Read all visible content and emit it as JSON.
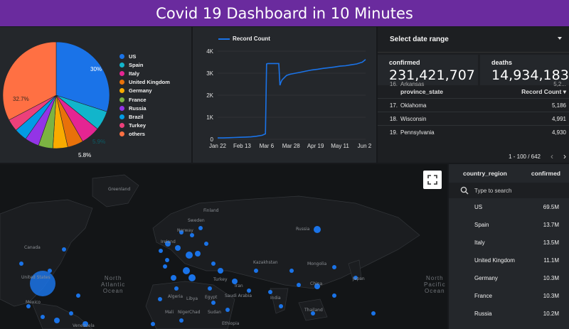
{
  "header": {
    "title": "Covid 19 Dashboard in 10 Minutes"
  },
  "colors": {
    "header_bg": "#6a2b9e",
    "accent_blue": "#1a73e8"
  },
  "pie": {
    "legend": [
      "US",
      "Spain",
      "Italy",
      "United Kingdom",
      "Germany",
      "France",
      "Russia",
      "Brazil",
      "Turkey",
      "others"
    ],
    "labels": {
      "us": "30%",
      "others": "32.7%",
      "spain": "5.9%",
      "turkey": "5.8%"
    }
  },
  "line": {
    "legend": "Record Count"
  },
  "date_range": {
    "label": "Select date range"
  },
  "scorecards": {
    "confirmed": {
      "label": "confirmed",
      "value": "231,421,707"
    },
    "deaths": {
      "label": "deaths",
      "value": "14,934,183"
    }
  },
  "province_table": {
    "headers": {
      "name": "province_state",
      "value": "Record Count"
    },
    "partial_top": {
      "idx": "16.",
      "name": "Arkansas",
      "value": "5,2..."
    },
    "rows": [
      {
        "idx": "17.",
        "name": "Oklahoma",
        "value": "5,186"
      },
      {
        "idx": "18.",
        "name": "Wisconsin",
        "value": "4,991"
      },
      {
        "idx": "19.",
        "name": "Pennsylvania",
        "value": "4,930"
      }
    ],
    "pager": "1 - 100 / 642"
  },
  "map": {
    "labels": {
      "greenland": "Greenland",
      "finland": "Finland",
      "sweden": "Sweden",
      "norway": "Norway",
      "russia": "Russia",
      "canada": "Canada",
      "ireland": "Ireland",
      "kazakhstan": "Kazakhstan",
      "united_states": "United States",
      "mexico": "Mexico",
      "algeria": "Algeria",
      "libya": "Libya",
      "egypt": "Egypt",
      "chad": "Chad",
      "sudan": "Sudan",
      "mali": "Mali",
      "niger": "Niger",
      "saudi": "Saudi Arabia",
      "turkey": "Turkey",
      "iran": "Iran",
      "china": "China",
      "india": "India",
      "japan": "Japan",
      "thailand": "Thailand",
      "venezuela": "Venezuela",
      "mongolia": "Mongolia",
      "ethiopia": "Ethiopia"
    },
    "oceans": {
      "atlantic": "North\nAtlantic\nOcean",
      "pacific": "North\nPacific\nOcean"
    }
  },
  "country_table": {
    "headers": {
      "name": "country_region",
      "value": "confirmed"
    },
    "search_placeholder": "Type to search",
    "rows": [
      {
        "name": "US",
        "value": "69.5M"
      },
      {
        "name": "Spain",
        "value": "13.7M"
      },
      {
        "name": "Italy",
        "value": "13.5M"
      },
      {
        "name": "United Kingdom",
        "value": "11.1M"
      },
      {
        "name": "Germany",
        "value": "10.3M"
      },
      {
        "name": "France",
        "value": "10.3M"
      },
      {
        "name": "Russia",
        "value": "10.2M"
      }
    ]
  },
  "chart_data": [
    {
      "type": "pie",
      "categories": [
        "US",
        "Spain",
        "Italy",
        "United Kingdom",
        "Germany",
        "France",
        "Russia",
        "Brazil",
        "Turkey",
        "others"
      ],
      "values": [
        30.0,
        5.9,
        5.8,
        4.8,
        4.5,
        4.4,
        4.3,
        3.9,
        3.7,
        32.7
      ],
      "colors": [
        "#1a73e8",
        "#12b5cb",
        "#e52592",
        "#e8710a",
        "#f9ab00",
        "#7cb342",
        "#9334e6",
        "#039be5",
        "#ec407a",
        "#ff7043"
      ],
      "legend_position": "right"
    },
    {
      "type": "line",
      "series": [
        {
          "name": "Record Count",
          "x_days": [
            0,
            5,
            10,
            15,
            20,
            25,
            30,
            35,
            40,
            43,
            44,
            45,
            50,
            55,
            56,
            57,
            58,
            60,
            62,
            65,
            70,
            75,
            80,
            85,
            90,
            95,
            100,
            105,
            110,
            115,
            120,
            125,
            130,
            133
          ],
          "values": [
            60,
            60,
            70,
            80,
            90,
            100,
            110,
            140,
            180,
            250,
            3420,
            3440,
            3440,
            3440,
            2450,
            2600,
            2700,
            2800,
            2900,
            2950,
            3000,
            3050,
            3100,
            3150,
            3180,
            3220,
            3250,
            3280,
            3320,
            3340,
            3380,
            3420,
            3500,
            3620
          ]
        }
      ],
      "x_ticks": [
        "Jan 22",
        "Feb 13",
        "Mar 6",
        "Mar 28",
        "Apr 19",
        "May 11",
        "Jun 2"
      ],
      "y_ticks": [
        "0",
        "1K",
        "2K",
        "3K",
        "4K"
      ],
      "ylim": [
        0,
        4000
      ],
      "grid": true
    }
  ]
}
